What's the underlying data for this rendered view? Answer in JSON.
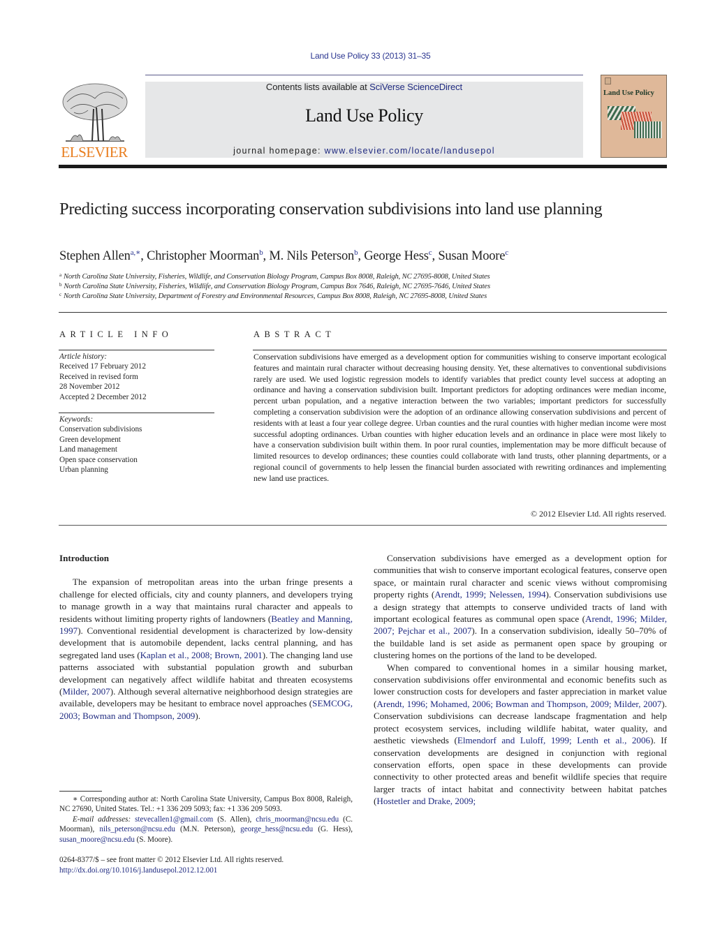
{
  "running_head": "Land Use Policy 33 (2013) 31–35",
  "masthead": {
    "publisher_logo_text": "ELSEVIER",
    "contents_prefix": "Contents lists available at ",
    "contents_link": "SciVerse ScienceDirect",
    "journal_title": "Land Use Policy",
    "homepage_prefix": "journal homepage: ",
    "homepage_link": "www.elsevier.com/locate/landusepol",
    "cover_title": "Land Use Policy",
    "colors": {
      "elsevier_orange": "#e87d1e",
      "link_blue": "#1f2a80",
      "box_gray": "#e6e7e8",
      "cover_tan": "#dfb899"
    }
  },
  "article": {
    "title": "Predicting success incorporating conservation subdivisions into land use planning",
    "authors": [
      {
        "name": "Stephen Allen",
        "marks": "a,∗"
      },
      {
        "name": "Christopher Moorman",
        "marks": "b"
      },
      {
        "name": "M. Nils Peterson",
        "marks": "b"
      },
      {
        "name": "George Hess",
        "marks": "c"
      },
      {
        "name": "Susan Moore",
        "marks": "c"
      }
    ],
    "affiliations": [
      {
        "mark": "a",
        "text": "North Carolina State University, Fisheries, Wildlife, and Conservation Biology Program, Campus Box 8008, Raleigh, NC 27695-8008, United States"
      },
      {
        "mark": "b",
        "text": "North Carolina State University, Fisheries, Wildlife, and Conservation Biology Program, Campus Box 7646, Raleigh, NC 27695-7646, United States"
      },
      {
        "mark": "c",
        "text": "North Carolina State University, Department of Forestry and Environmental Resources, Campus Box 8008, Raleigh, NC 27695-8008, United States"
      }
    ]
  },
  "article_info": {
    "heading": "ARTICLE INFO",
    "history_label": "Article history:",
    "history": [
      "Received 17 February 2012",
      "Received in revised form",
      "28 November 2012",
      "Accepted 2 December 2012"
    ],
    "keywords_label": "Keywords:",
    "keywords": [
      "Conservation subdivisions",
      "Green development",
      "Land management",
      "Open space conservation",
      "Urban planning"
    ]
  },
  "abstract": {
    "heading": "ABSTRACT",
    "text": "Conservation subdivisions have emerged as a development option for communities wishing to conserve important ecological features and maintain rural character without decreasing housing density. Yet, these alternatives to conventional subdivisions rarely are used. We used logistic regression models to identify variables that predict county level success at adopting an ordinance and having a conservation subdivision built. Important predictors for adopting ordinances were median income, percent urban population, and a negative interaction between the two variables; important predictors for successfully completing a conservation subdivision were the adoption of an ordinance allowing conservation subdivisions and percent of residents with at least a four year college degree. Urban counties and the rural counties with higher median income were most successful adopting ordinances. Urban counties with higher education levels and an ordinance in place were most likely to have a conservation subdivision built within them. In poor rural counties, implementation may be more difficult because of limited resources to develop ordinances; these counties could collaborate with land trusts, other planning departments, or a regional council of governments to help lessen the financial burden associated with rewriting ordinances and implementing new land use practices.",
    "copyright": "© 2012 Elsevier Ltd. All rights reserved."
  },
  "body": {
    "intro_heading": "Introduction",
    "left_paragraph": [
      {
        "t": "The expansion of metropolitan areas into the urban fringe presents a challenge for elected officials, city and county planners, and developers trying to manage growth in a way that maintains rural character and appeals to residents without limiting property rights of landowners ("
      },
      {
        "cite": "Beatley and Manning, 1997"
      },
      {
        "t": "). Conventional residential development is characterized by low-density development that is automobile dependent, lacks central planning, and has segregated land uses ("
      },
      {
        "cite": "Kaplan et al., 2008; Brown, 2001"
      },
      {
        "t": "). The changing land use patterns associated with substantial population growth and suburban development can negatively affect wildlife habitat and threaten ecosystems ("
      },
      {
        "cite": "Milder, 2007"
      },
      {
        "t": "). Although several alternative neighborhood design strategies are available, developers may be hesitant to embrace novel approaches ("
      },
      {
        "cite": "SEMCOG, 2003; Bowman and Thompson, 2009"
      },
      {
        "t": ")."
      }
    ],
    "right_paragraph_1": [
      {
        "t": "Conservation subdivisions have emerged as a development option for communities that wish to conserve important ecological features, conserve open space, or maintain rural character and scenic views without compromising property rights ("
      },
      {
        "cite": "Arendt, 1999; Nelessen, 1994"
      },
      {
        "t": "). Conservation subdivisions use a design strategy that attempts to conserve undivided tracts of land with important ecological features as communal open space ("
      },
      {
        "cite": "Arendt, 1996; Milder, 2007; Pejchar et al., 2007"
      },
      {
        "t": "). In a conservation subdivision, ideally 50–70% of the buildable land is set aside as permanent open space by grouping or clustering homes on the portions of the land to be developed."
      }
    ],
    "right_paragraph_2": [
      {
        "t": "When compared to conventional homes in a similar housing market, conservation subdivisions offer environmental and economic benefits such as lower construction costs for developers and faster appreciation in market value ("
      },
      {
        "cite": "Arendt, 1996; Mohamed, 2006; Bowman and Thompson, 2009; Milder, 2007"
      },
      {
        "t": "). Conservation subdivisions can decrease landscape fragmentation and help protect ecosystem services, including wildlife habitat, water quality, and aesthetic viewsheds ("
      },
      {
        "cite": "Elmendorf and Luloff, 1999; Lenth et al., 2006"
      },
      {
        "t": "). If conservation developments are designed in conjunction with regional conservation efforts, open space in these developments can provide connectivity to other protected areas and benefit wildlife species that require larger tracts of intact habitat and connectivity between habitat patches ("
      },
      {
        "cite": "Hostetler and Drake, 2009;"
      }
    ]
  },
  "footnotes": {
    "corresponding": "∗ Corresponding author at: North Carolina State University, Campus Box 8008, Raleigh, NC 27690, United States. Tel.: +1 336 209 5093; fax: +1 336 209 5093.",
    "email_label": "E-mail addresses:",
    "emails": [
      {
        "email": "stevecallen1@gmail.com",
        "who": " (S. Allen), "
      },
      {
        "email": "chris_moorman@ncsu.edu",
        "who": " (C. Moorman), "
      },
      {
        "email": "nils_peterson@ncsu.edu",
        "who": " (M.N. Peterson), "
      },
      {
        "email": "george_hess@ncsu.edu",
        "who": " (G. Hess), "
      },
      {
        "email": "susan_moore@ncsu.edu",
        "who": " (S. Moore)."
      }
    ],
    "front_matter": "0264-8377/$ – see front matter © 2012 Elsevier Ltd. All rights reserved.",
    "doi": "http://dx.doi.org/10.1016/j.landusepol.2012.12.001"
  }
}
